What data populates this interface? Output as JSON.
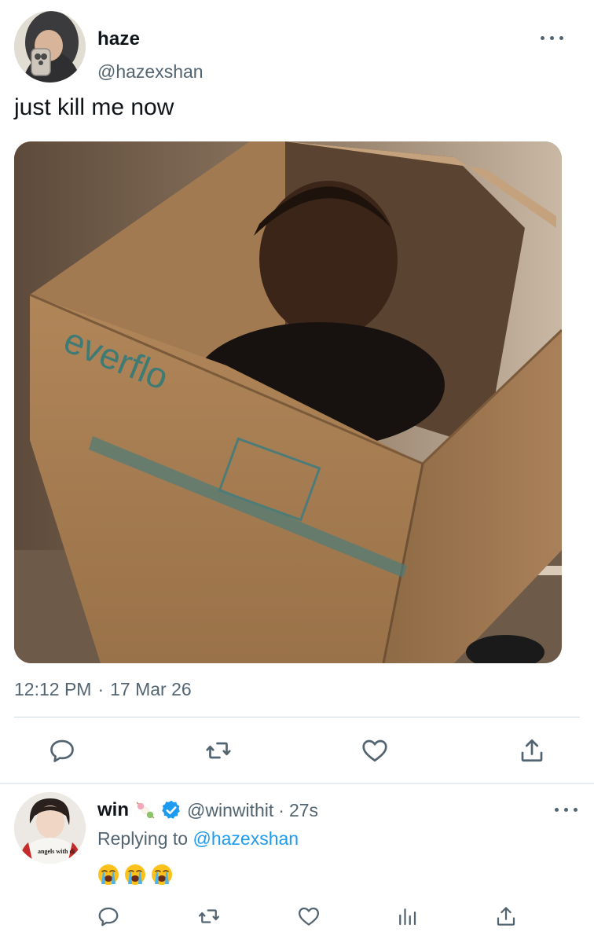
{
  "tweet": {
    "author_name": "haze",
    "author_handle": "@hazexshan",
    "text": "just kill me now",
    "time": "12:12 PM",
    "separator": "·",
    "date": "17 Mar 26",
    "photo_text": "everflo"
  },
  "actions": {
    "icons": [
      "reply-icon",
      "retweet-icon",
      "like-icon",
      "share-icon"
    ]
  },
  "reply": {
    "author_name": "win",
    "author_handle": "@winwithit",
    "separator": "·",
    "time": "27s",
    "replying_prefix": "Replying to",
    "replying_handle": "@hazexshan",
    "emoji_count": 3,
    "avatar_shirt_text": "angels with di",
    "icons": [
      "reply-icon",
      "retweet-icon",
      "like-icon",
      "analytics-icon",
      "share-icon"
    ]
  },
  "colors": {
    "text_primary": "#0f1419",
    "text_secondary": "#536471",
    "link": "#1d9bf0",
    "divider": "#cfd9de",
    "verified": "#1d9bf0"
  }
}
